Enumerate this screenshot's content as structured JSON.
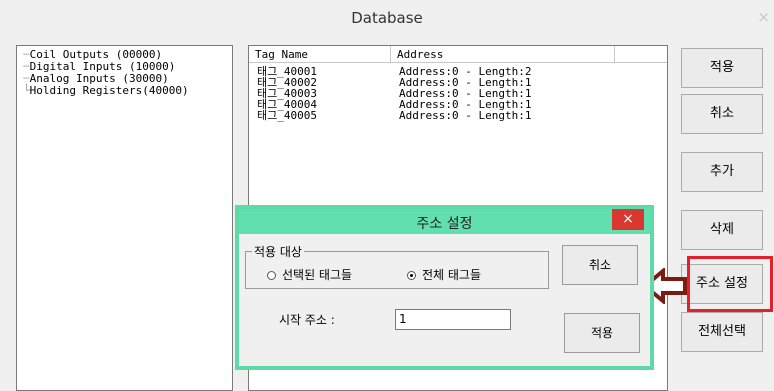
{
  "window": {
    "title": "Database",
    "close_glyph": "×"
  },
  "tree": {
    "items": [
      {
        "label": "Coil Outputs (00000)"
      },
      {
        "label": "Digital Inputs (10000)"
      },
      {
        "label": "Analog Inputs (30000)"
      },
      {
        "label": "Holding Registers(40000)"
      }
    ]
  },
  "tag_list": {
    "columns": [
      "Tag Name",
      "Address"
    ],
    "rows": [
      {
        "name": "태그_40001",
        "address": "Address:0 - Length:2"
      },
      {
        "name": "태그_40002",
        "address": "Address:0 - Length:1"
      },
      {
        "name": "태그_40003",
        "address": "Address:0 - Length:1"
      },
      {
        "name": "태그_40004",
        "address": "Address:0 - Length:1"
      },
      {
        "name": "태그_40005",
        "address": "Address:0 - Length:1"
      }
    ]
  },
  "side_buttons": {
    "apply": "적용",
    "cancel": "취소",
    "add": "추가",
    "delete": "삭제",
    "address_setting": "주소 설정",
    "select_all": "전체선택"
  },
  "dialog": {
    "title": "주소 설정",
    "close_glyph": "×",
    "target_group": "적용 대상",
    "option_selected": "선택된 태그들",
    "option_all": "전체 태그들",
    "selected_option": "all",
    "start_address_label": "시작 주소 :",
    "start_address_value": "1",
    "cancel_label": "취소",
    "apply_label": "적용"
  },
  "annotation": {
    "highlight_color": "#e5202a",
    "arrow_color": "#7b1c12"
  },
  "icons": {
    "arrow": "left-arrow-icon",
    "close": "close-icon"
  }
}
